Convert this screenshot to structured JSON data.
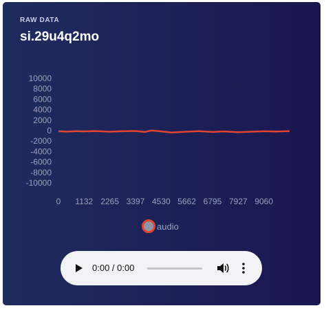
{
  "card": {
    "eyebrow": "RAW DATA",
    "title": "si.29u4q2mo"
  },
  "chart_data": {
    "type": "line",
    "title": "",
    "xlabel": "",
    "ylabel": "",
    "ylim": [
      -10000,
      10000
    ],
    "xlim": [
      0,
      10192
    ],
    "yticks": [
      "10000",
      "8000",
      "6000",
      "4000",
      "2000",
      "0",
      "-2000",
      "-4000",
      "-6000",
      "-8000",
      "-10000"
    ],
    "xticks": [
      "0",
      "1132",
      "2265",
      "3397",
      "4530",
      "5662",
      "6795",
      "7927",
      "9060"
    ],
    "series": [
      {
        "name": "audio",
        "color": "#e2442f",
        "x": [
          0,
          400,
          800,
          1132,
          1600,
          2265,
          2800,
          3397,
          3800,
          4100,
          4530,
          5000,
          5662,
          6200,
          6795,
          7300,
          7927,
          8500,
          9060,
          9600,
          10192
        ],
        "values": [
          -120,
          -180,
          -100,
          -150,
          -80,
          -200,
          -120,
          -60,
          -250,
          30,
          -150,
          -350,
          -200,
          -100,
          -250,
          -150,
          -300,
          -200,
          -120,
          -160,
          -100
        ]
      }
    ],
    "legend": {
      "position": "bottom",
      "label": "audio"
    },
    "grid": false
  },
  "player": {
    "time": "0:00 / 0:00",
    "progress": 0,
    "icons": {
      "play": "play-icon",
      "volume": "volume-icon",
      "more": "more-vert-icon"
    }
  }
}
